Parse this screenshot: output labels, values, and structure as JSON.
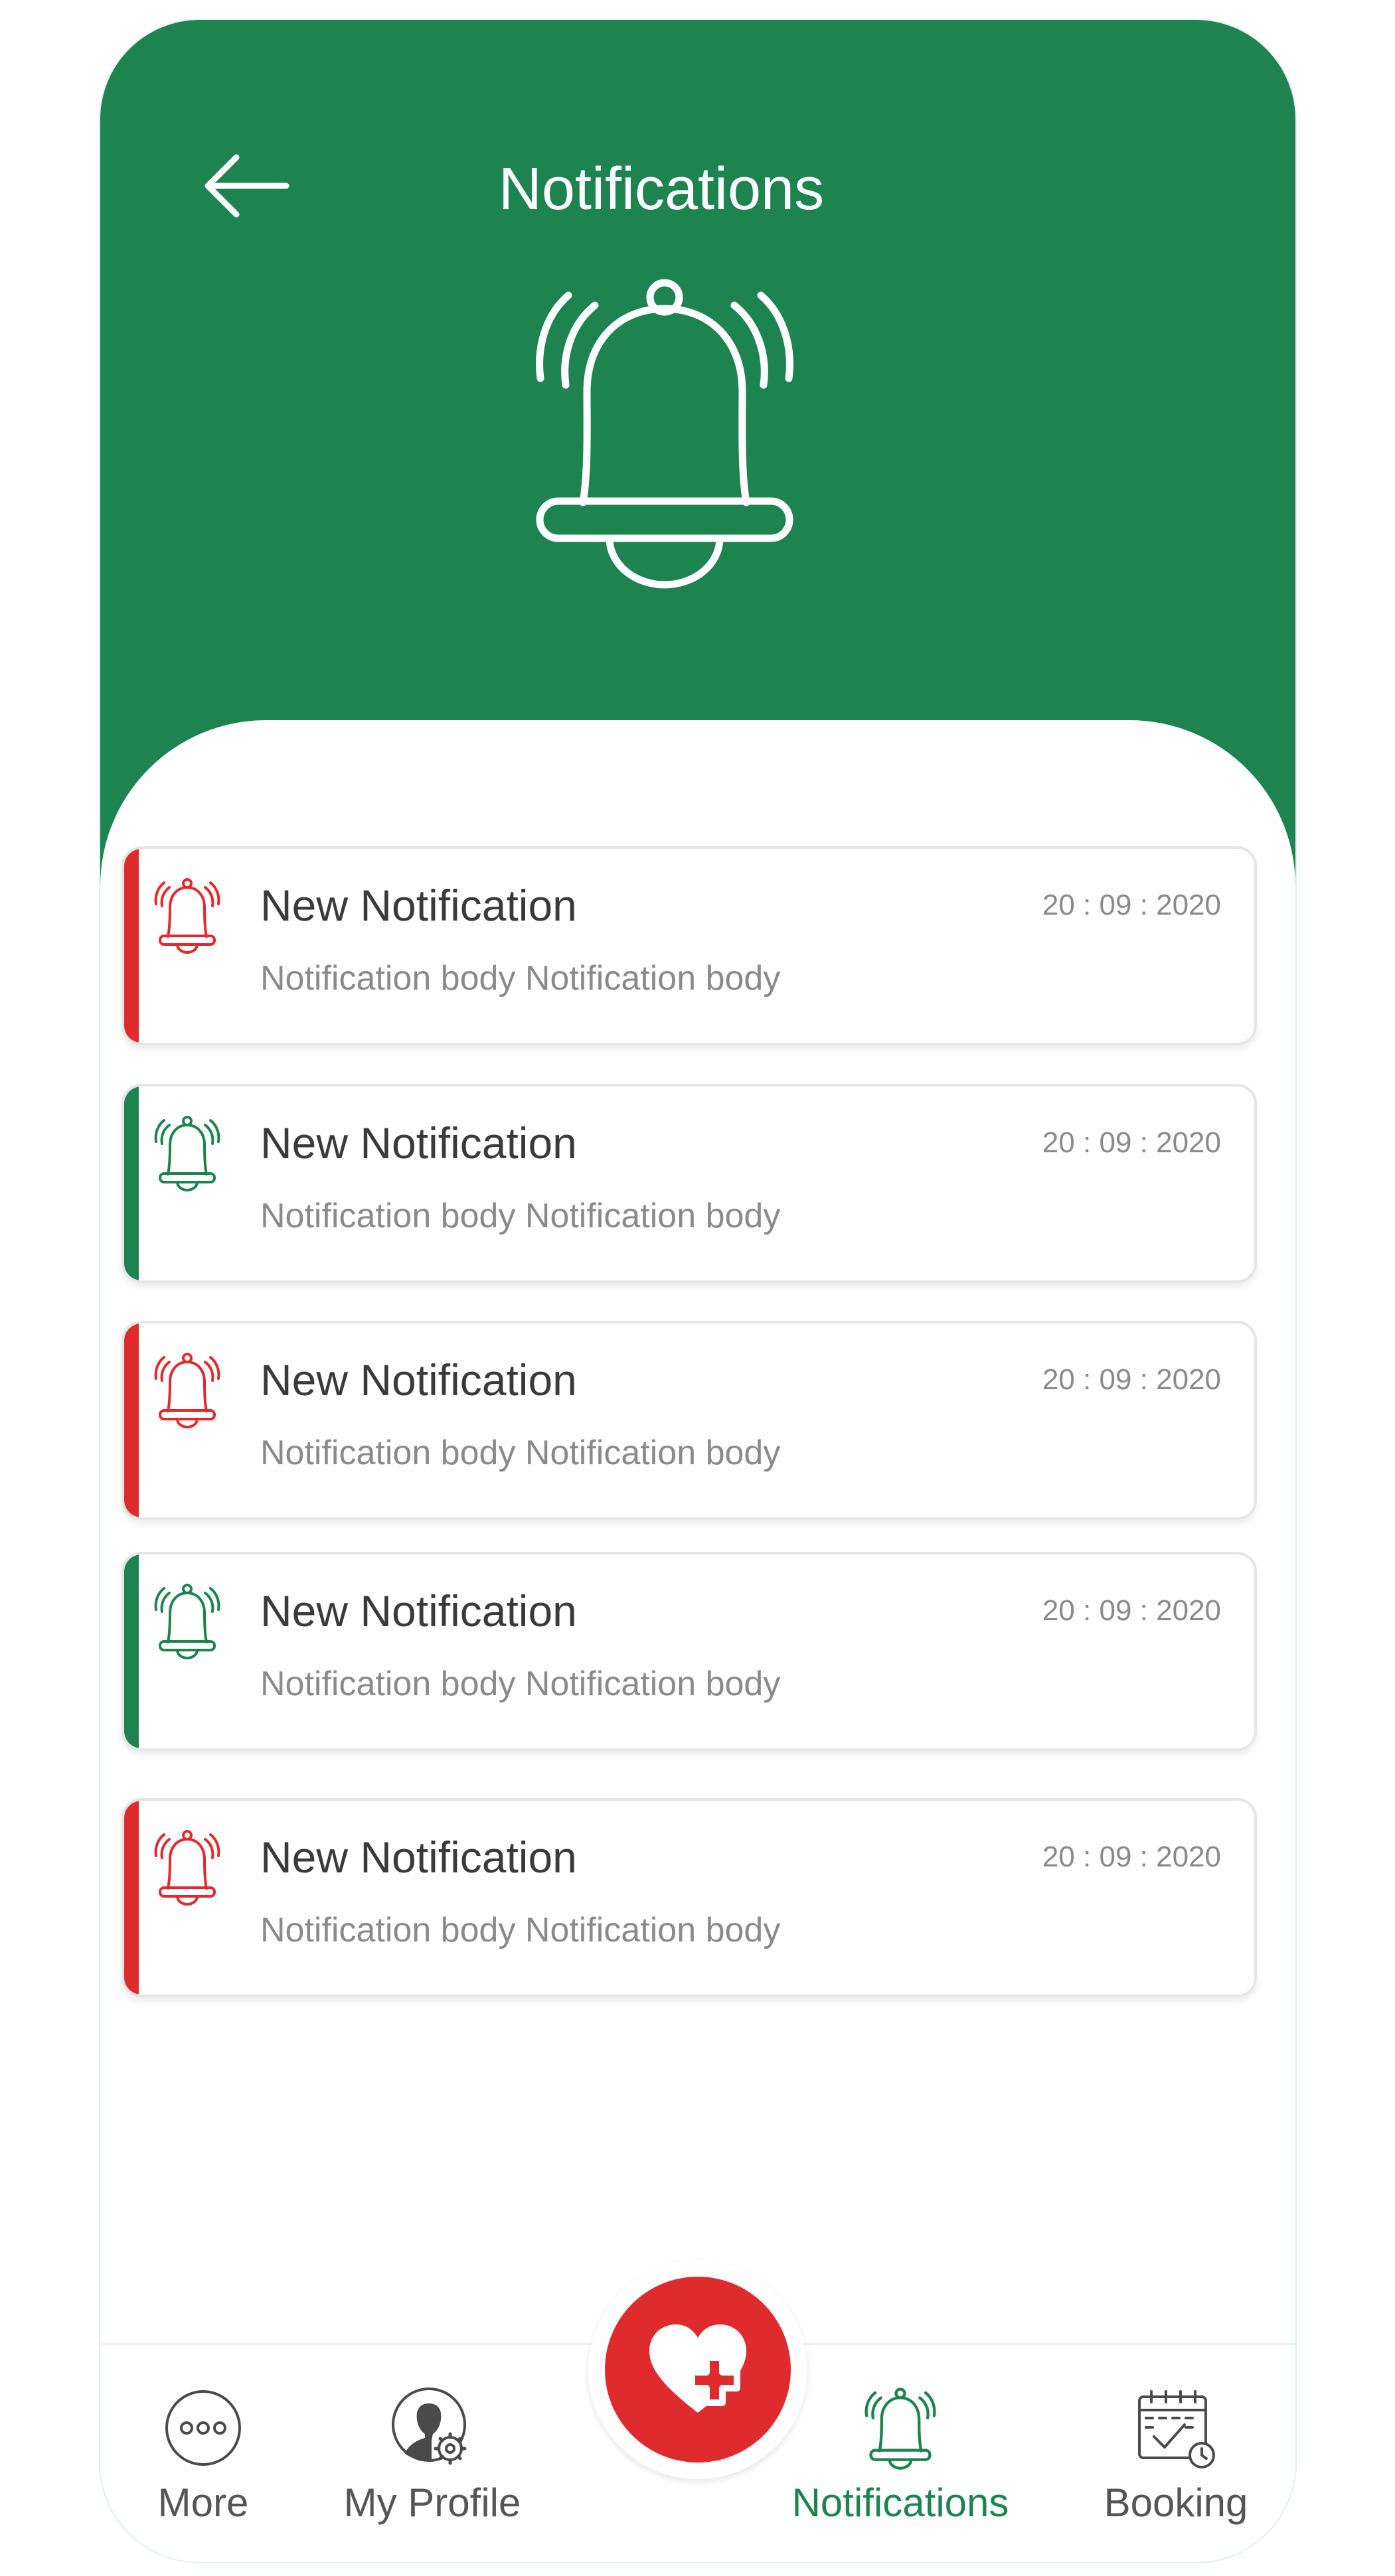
{
  "colors": {
    "header_green": "#1d834f",
    "unread_red": "#e02b2e",
    "read_green": "#1d834f",
    "title_gray": "#3a3a3a",
    "meta_gray": "#8a8a8a"
  },
  "header": {
    "title": "Notifications",
    "back_icon": "arrow-left-icon",
    "hero_icon": "ringing-bell-icon"
  },
  "notifications": [
    {
      "title": "New Notification",
      "time": "20 : 09 : 2020",
      "body": "Notification body Notification body",
      "status": "red"
    },
    {
      "title": "New Notification",
      "time": "20 : 09 : 2020",
      "body": "Notification body Notification body",
      "status": "green"
    },
    {
      "title": "New Notification",
      "time": "20 : 09 : 2020",
      "body": "Notification body Notification body",
      "status": "red"
    },
    {
      "title": "New Notification",
      "time": "20 : 09 : 2020",
      "body": "Notification body Notification body",
      "status": "green"
    },
    {
      "title": "New Notification",
      "time": "20 : 09 : 2020",
      "body": "Notification body Notification body",
      "status": "red"
    }
  ],
  "tabbar": {
    "tabs": [
      {
        "label": "More",
        "icon": "more-dots-icon",
        "active": false
      },
      {
        "label": "My Profile",
        "icon": "profile-settings-icon",
        "active": false
      },
      {
        "label": "Notifications",
        "icon": "bell-icon",
        "active": true
      },
      {
        "label": "Booking",
        "icon": "calendar-check-icon",
        "active": false
      }
    ],
    "center_button_icon": "heart-plus-icon"
  }
}
